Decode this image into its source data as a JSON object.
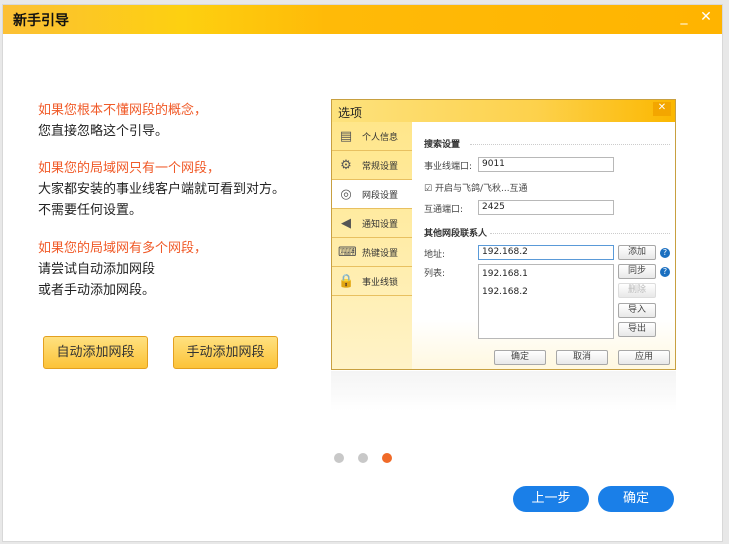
{
  "window": {
    "title": "新手引导",
    "minimize": "_",
    "close": "✕"
  },
  "guide": {
    "p1": [
      "如果您根本不懂网段的概念，",
      "您直接忽略这个引导。"
    ],
    "p2": [
      "如果您的局域网只有一个网段，",
      "大家都安装的事业线客户端就可看到对方。",
      "不需要任何设置。"
    ],
    "p3": [
      "如果您的局域网有多个网段，",
      "请尝试自动添加网段",
      "或者手动添加网段。"
    ]
  },
  "buttons": {
    "auto_add": "自动添加网段",
    "manual_add": "手动添加网段",
    "prev": "上一步",
    "ok": "确定"
  },
  "options_dialog": {
    "title": "选项",
    "close": "✕",
    "sidebar": [
      {
        "label": "个人信息",
        "icon": "▤"
      },
      {
        "label": "常规设置",
        "icon": "⚙"
      },
      {
        "label": "网段设置",
        "icon": "◎"
      },
      {
        "label": "通知设置",
        "icon": "◀"
      },
      {
        "label": "热键设置",
        "icon": "⌨"
      },
      {
        "label": "事业线锁",
        "icon": "🔒"
      }
    ],
    "search_section": "搜索设置",
    "port_label": "事业线端口:",
    "port_value": "9011",
    "interop_checkbox": "开启与飞鸽/飞秋...互通",
    "interop_port_label": "互通端口:",
    "interop_port_value": "2425",
    "other_section": "其他网段联系人",
    "address_label": "地址:",
    "address_value": "192.168.2",
    "list_label": "列表:",
    "list": [
      "192.168.1",
      "192.168.2"
    ],
    "side_buttons": {
      "add": "添加",
      "sync": "同步",
      "delete": "删除",
      "import": "导入",
      "export": "导出"
    },
    "help": "?",
    "footer": {
      "ok": "确定",
      "cancel": "取消",
      "apply": "应用"
    }
  },
  "pager": {
    "pages": 3,
    "current": 3
  }
}
